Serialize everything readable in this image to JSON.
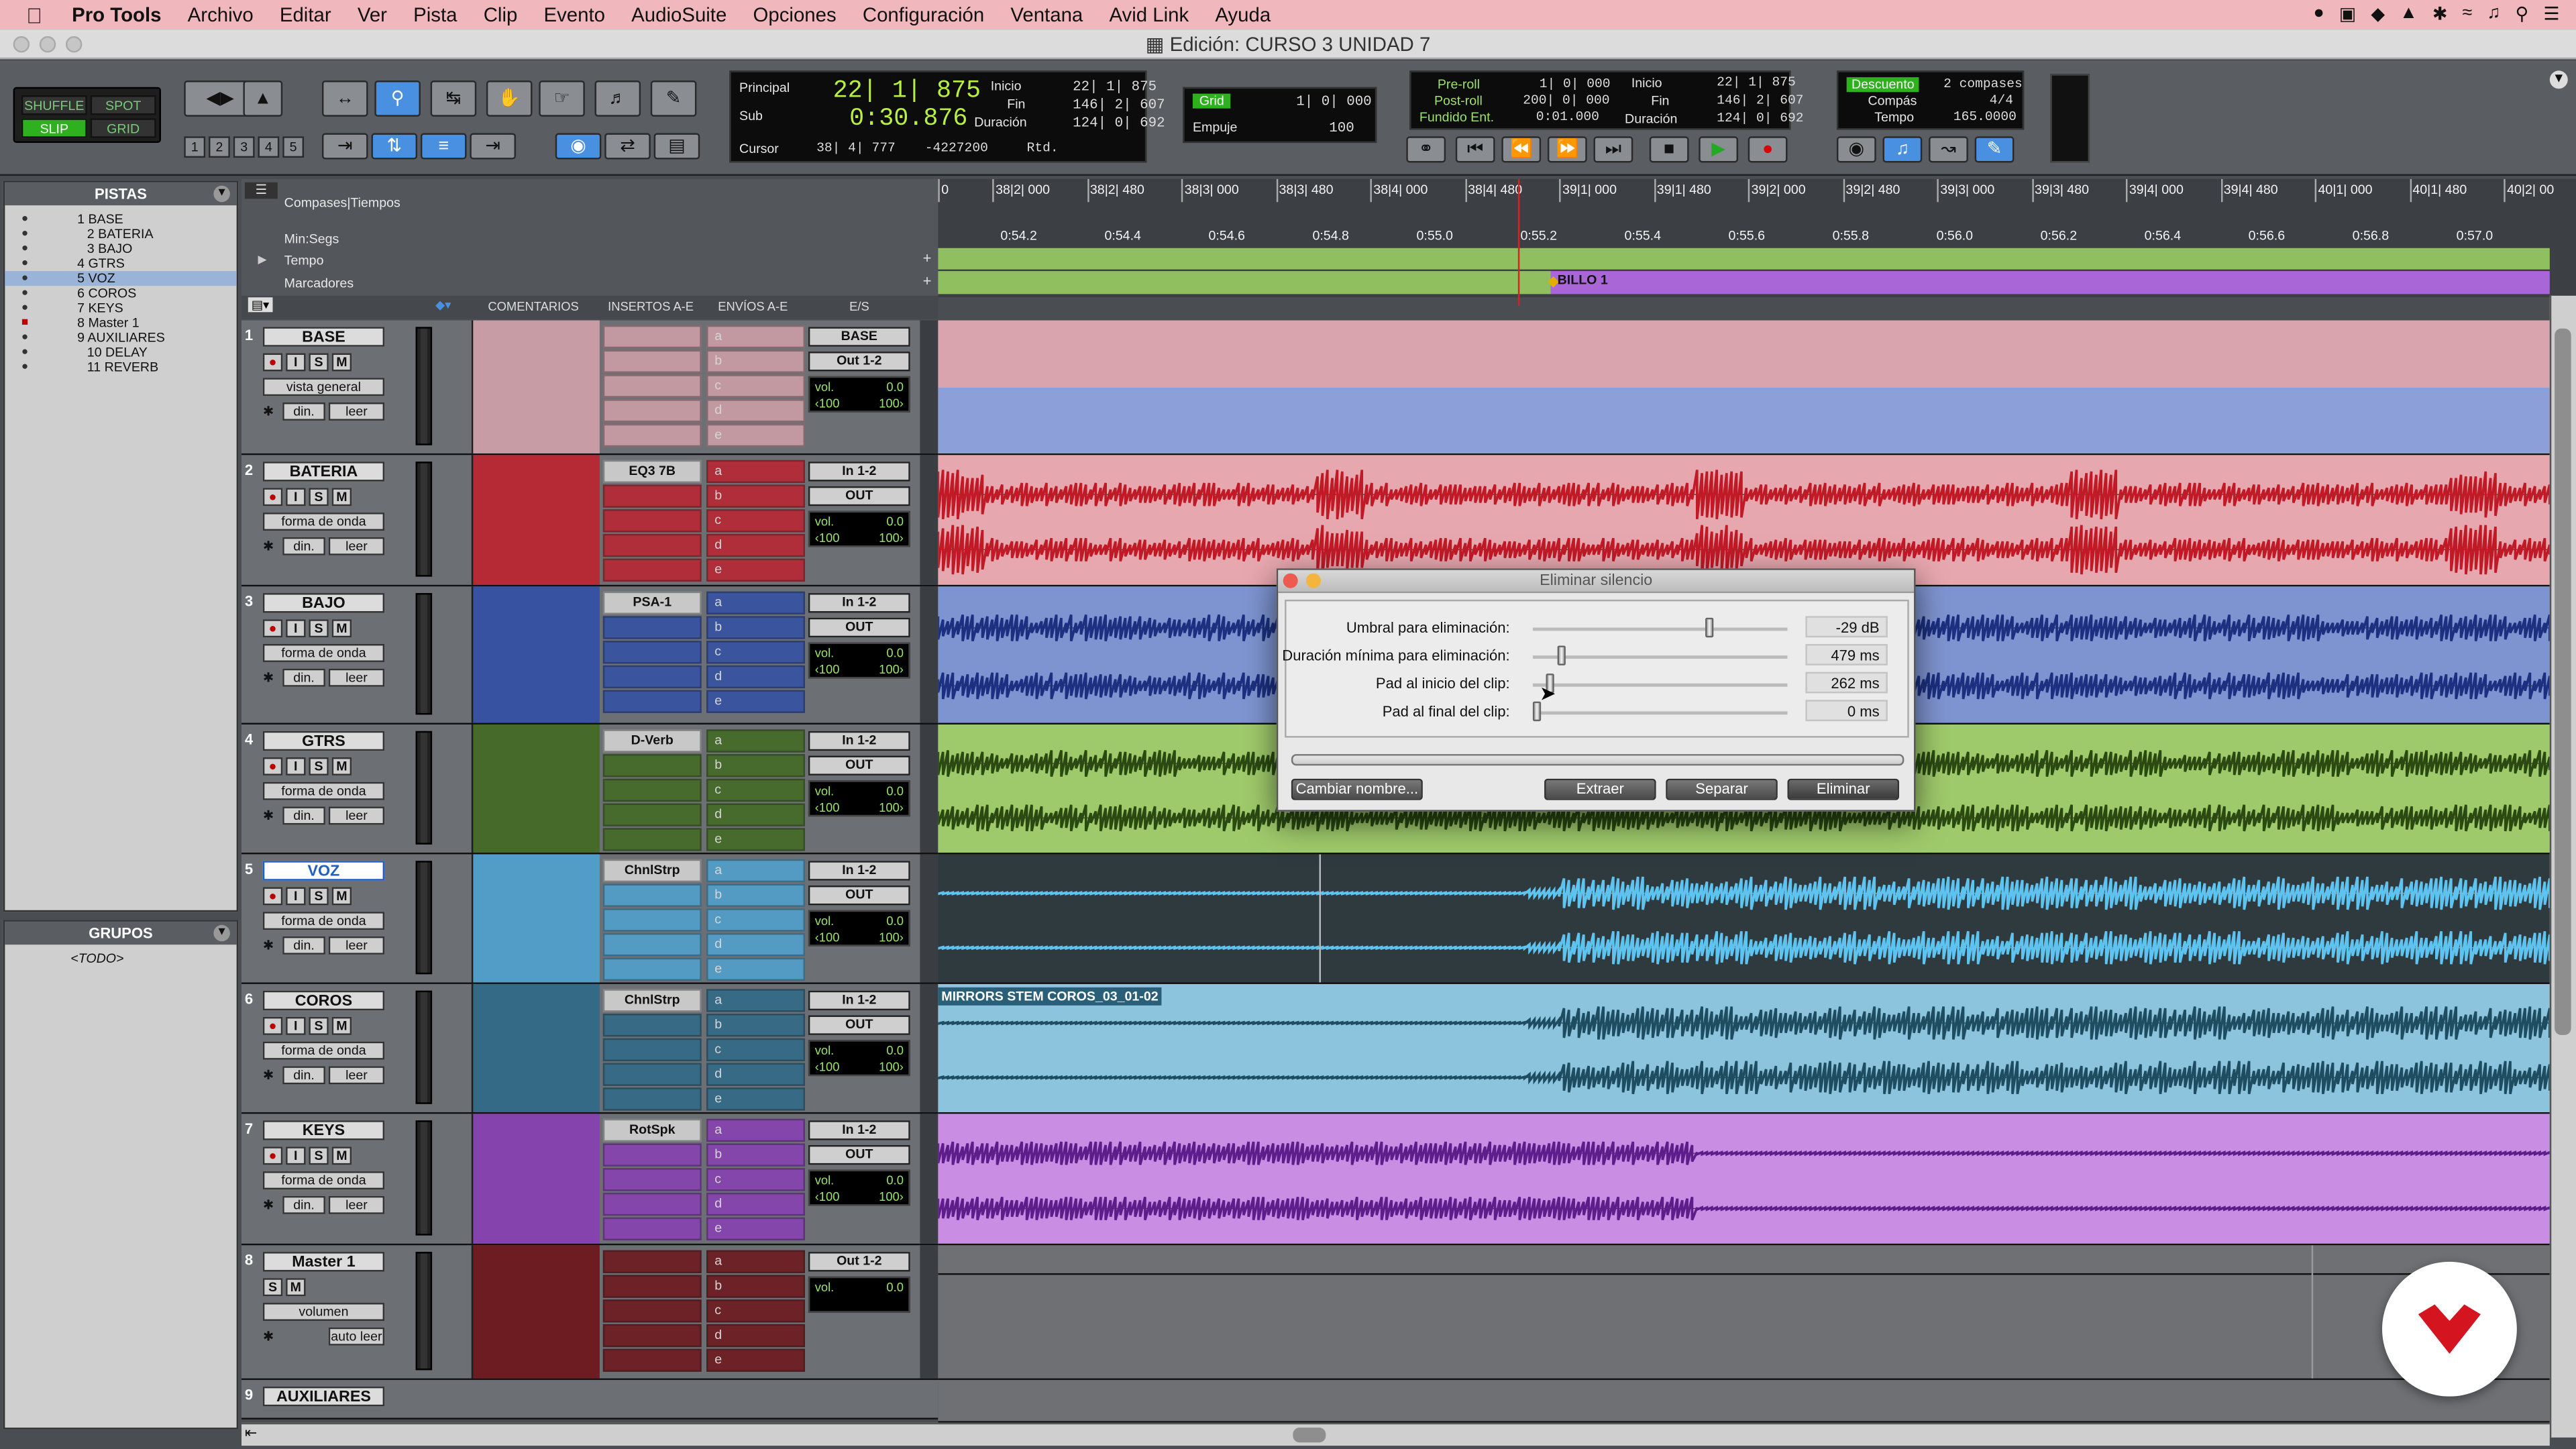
{
  "menubar": {
    "apple": "",
    "app": "Pro Tools",
    "items": [
      "Archivo",
      "Editar",
      "Ver",
      "Pista",
      "Clip",
      "Evento",
      "AudioSuite",
      "Opciones",
      "Configuración",
      "Ventana",
      "Avid Link",
      "Ayuda"
    ]
  },
  "window": {
    "title": "Edición: CURSO 3 UNIDAD 7"
  },
  "modes": {
    "shuffle": "SHUFFLE",
    "spot": "SPOT",
    "slip": "SLIP",
    "grid": "GRID"
  },
  "zoom_presets": [
    "1",
    "2",
    "3",
    "4",
    "5"
  ],
  "counter": {
    "main_label": "Principal",
    "main_value": "22| 1| 875",
    "sub_label": "Sub",
    "sub_value": "0:30.876",
    "cursor_label": "Cursor",
    "cursor_value": "38| 4| 777",
    "cursor_extra": "-4227200",
    "rtd": "Rtd.",
    "inicio_label": "Inicio",
    "inicio_value": "22| 1| 875",
    "fin_label": "Fin",
    "fin_value": "146| 2| 607",
    "duracion_label": "Duración",
    "duracion_value": "124| 0| 692"
  },
  "grid": {
    "grid_label": "Grid",
    "grid_value": "1| 0| 000",
    "empuje_label": "Empuje",
    "empuje_value": "100"
  },
  "transport": {
    "preroll_label": "Pre-roll",
    "preroll_value": "1| 0| 000",
    "postroll_label": "Post-roll",
    "postroll_value": "200| 0| 000",
    "fade_label": "Fundido Ent.",
    "fade_value": "0:01.000",
    "inicio_label": "Inicio",
    "inicio_value": "22| 1| 875",
    "fin_label": "Fin",
    "fin_value": "146| 2| 607",
    "duracion_label": "Duración",
    "duracion_value": "124| 0| 692"
  },
  "countoff": {
    "descuento": "Descuento",
    "compases_val": "2 compases",
    "compas_label": "Compás",
    "compas_value": "4/4",
    "tempo_label": "Tempo",
    "tempo_value": "165.0000"
  },
  "tracklist": {
    "title": "PISTAS",
    "items": [
      "1 BASE",
      "2 BATERIA",
      "3 BAJO",
      "4 GTRS",
      "5 VOZ",
      "6 COROS",
      "7 KEYS",
      "8 Master 1",
      "9 AUXILIARES",
      "10 DELAY",
      "11 REVERB"
    ]
  },
  "groups": {
    "title": "GRUPOS",
    "item": "<TODO>"
  },
  "rulers": {
    "bars": "Compases|Tiempos",
    "minsecs": "Min:Segs",
    "tempo": "Tempo",
    "markers": "Marcadores"
  },
  "columns": {
    "comments": "COMENTARIOS",
    "inserts": "INSERTOS A-E",
    "sends": "ENVÍOS A-E",
    "io": "E/S"
  },
  "bars_ticks": [
    "0",
    "38|2| 000",
    "38|2| 480",
    "38|3| 000",
    "38|3| 480",
    "38|4| 000",
    "38|4| 480",
    "39|1| 000",
    "39|1| 480",
    "39|2| 000",
    "39|2| 480",
    "39|3| 000",
    "39|3| 480",
    "39|4| 000",
    "39|4| 480",
    "40|1| 000",
    "40|1| 480",
    "40|2| 00"
  ],
  "min_ticks": [
    "0:54.2",
    "0:54.4",
    "0:54.6",
    "0:54.8",
    "0:55.0",
    "0:55.2",
    "0:55.4",
    "0:55.6",
    "0:55.8",
    "0:56.0",
    "0:56.2",
    "0:56.4",
    "0:56.6",
    "0:56.8",
    "0:57.0"
  ],
  "marker": "BILLO 1",
  "send_letters": [
    "a",
    "b",
    "c",
    "d",
    "e"
  ],
  "tracks": [
    {
      "num": "1",
      "name": "BASE",
      "view": "vista general",
      "auto1": "din.",
      "auto2": "leer",
      "insert": "",
      "in": "BASE",
      "out": "Out 1-2",
      "vol": "0.0",
      "panL": "‹100",
      "panR": "100›"
    },
    {
      "num": "2",
      "name": "BATERIA",
      "view": "forma de onda",
      "auto1": "din.",
      "auto2": "leer",
      "insert": "EQ3 7B",
      "in": "In 1-2",
      "out": "OUT",
      "vol": "0.0",
      "panL": "‹100",
      "panR": "100›"
    },
    {
      "num": "3",
      "name": "BAJO",
      "view": "forma de onda",
      "auto1": "din.",
      "auto2": "leer",
      "insert": "PSA-1",
      "in": "In 1-2",
      "out": "OUT",
      "vol": "0.0",
      "panL": "‹100",
      "panR": "100›"
    },
    {
      "num": "4",
      "name": "GTRS",
      "view": "forma de onda",
      "auto1": "din.",
      "auto2": "leer",
      "insert": "D-Verb",
      "in": "In 1-2",
      "out": "OUT",
      "vol": "0.0",
      "panL": "‹100",
      "panR": "100›"
    },
    {
      "num": "5",
      "name": "VOZ",
      "view": "forma de onda",
      "auto1": "din.",
      "auto2": "leer",
      "insert": "ChnlStrp",
      "in": "In 1-2",
      "out": "OUT",
      "vol": "0.0",
      "panL": "‹100",
      "panR": "100›"
    },
    {
      "num": "6",
      "name": "COROS",
      "view": "forma de onda",
      "auto1": "din.",
      "auto2": "leer",
      "insert": "ChnlStrp",
      "in": "In 1-2",
      "out": "OUT",
      "vol": "0.0",
      "panL": "‹100",
      "panR": "100›"
    },
    {
      "num": "7",
      "name": "KEYS",
      "view": "forma de onda",
      "auto1": "din.",
      "auto2": "leer",
      "insert": "RotSpk",
      "in": "In 1-2",
      "out": "OUT",
      "vol": "0.0",
      "panL": "‹100",
      "panR": "100›"
    },
    {
      "num": "8",
      "name": "Master 1",
      "view": "volumen",
      "auto1": "",
      "auto2": "auto leer",
      "insert": "",
      "in": "Out 1-2",
      "out": "",
      "vol": "0.0",
      "panL": "",
      "panR": ""
    },
    {
      "num": "9",
      "name": "AUXILIARES",
      "view": "",
      "auto1": "",
      "auto2": "",
      "insert": "",
      "in": "",
      "out": "",
      "vol": "",
      "panL": "",
      "panR": ""
    }
  ],
  "clip_label": "MIRRORS STEM COROS_03_01-02",
  "dialog": {
    "title": "Eliminar silencio",
    "rows": [
      {
        "label": "Umbral para eliminación:",
        "value": "-29 dB",
        "level": 0.7
      },
      {
        "label": "Duración mínima para eliminación:",
        "value": "479 ms",
        "level": 0.1
      },
      {
        "label": "Pad al inicio del clip:",
        "value": "262 ms",
        "level": 0.05
      },
      {
        "label": "Pad al final del clip:",
        "value": "0 ms",
        "level": 0.0
      }
    ],
    "rename": "Cambiar nombre...",
    "extract": "Extraer",
    "separate": "Separar",
    "remove": "Eliminar"
  },
  "colors": {
    "base": "#d9a4ad",
    "bateria": "#c21f2b",
    "bajo": "#2e4ea8",
    "gtrs": "#3f6a1c",
    "voz": "#4ea6d6",
    "coros": "#2b6a88",
    "keys": "#8a3cb8",
    "master": "#6e0f14"
  }
}
